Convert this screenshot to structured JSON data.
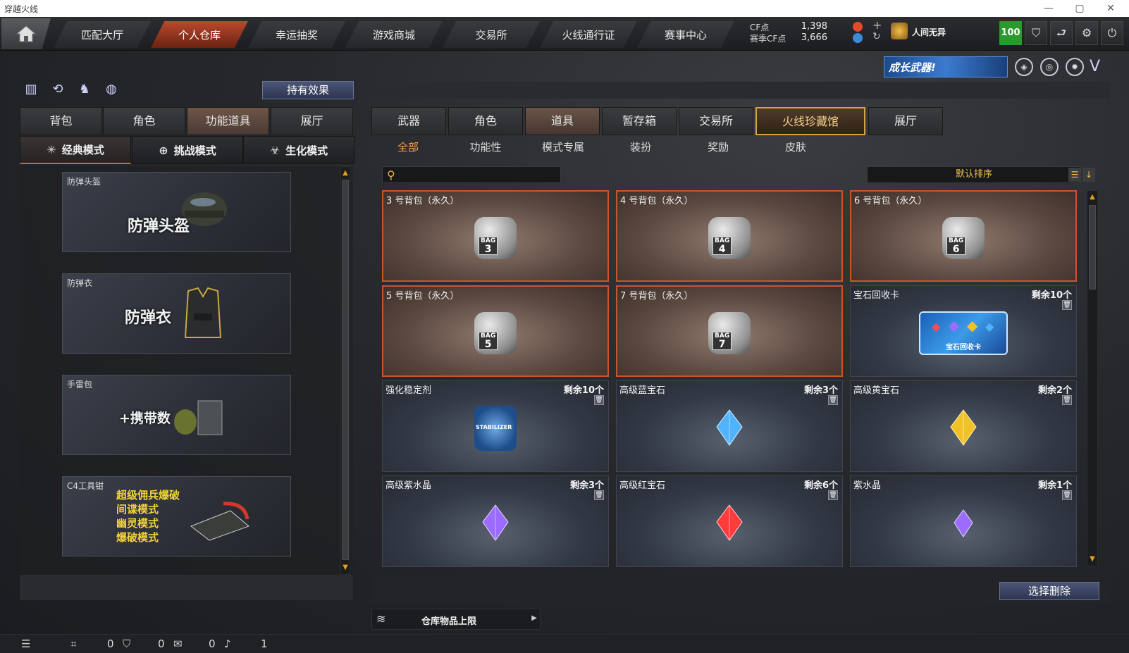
{
  "window": {
    "title": "穿越火线"
  },
  "topnav": {
    "tabs": [
      {
        "label": "匹配大厅"
      },
      {
        "label": "个人仓库"
      },
      {
        "label": "幸运抽奖"
      },
      {
        "label": "游戏商城"
      },
      {
        "label": "交易所"
      },
      {
        "label": "火线通行证"
      },
      {
        "label": "赛事中心"
      }
    ],
    "active_tab": "个人仓库",
    "cf_label": "CF点",
    "cf_value": "1,398",
    "season_cf_label": "赛季CF点",
    "season_cf_value": "3,666",
    "username": "人间无异",
    "level": "100",
    "icons": [
      "home-icon",
      "plus-icon",
      "refresh-icon",
      "rank-emblem-icon",
      "shield-icon",
      "return-icon",
      "gear-icon",
      "power-icon"
    ]
  },
  "banner": {
    "text": "成长武器!"
  },
  "left": {
    "hold_effect_label": "持有效果",
    "tabs": [
      "背包",
      "角色",
      "功能道具",
      "展厅"
    ],
    "active_tab": "功能道具",
    "modes": [
      "经典模式",
      "挑战模式",
      "生化模式"
    ],
    "active_mode": "经典模式",
    "cards": [
      {
        "caption": "防弹头盔",
        "big": "防弹头盔"
      },
      {
        "caption": "防弹衣",
        "big": "防弹衣"
      },
      {
        "caption": "手雷包",
        "big": "+携带数"
      },
      {
        "caption": "C4工具钳",
        "lines": [
          "超级佣兵爆破",
          "间谍模式",
          "幽灵模式",
          "爆破模式"
        ]
      }
    ]
  },
  "right": {
    "tabs": [
      "武器",
      "角色",
      "道具",
      "暂存箱",
      "交易所",
      "火线珍藏馆",
      "展厅"
    ],
    "active_tab": "火线珍藏馆",
    "subtabs": [
      "全部",
      "功能性",
      "模式专属",
      "装扮",
      "奖励",
      "皮肤"
    ],
    "active_subtab": "全部",
    "search_placeholder": "",
    "sort_label": "默认排序",
    "items": [
      {
        "name": "3 号背包（永久）",
        "count": "",
        "type": "bag",
        "bag_no": "3"
      },
      {
        "name": "4 号背包（永久）",
        "count": "",
        "type": "bag",
        "bag_no": "4"
      },
      {
        "name": "6 号背包（永久）",
        "count": "",
        "type": "bag",
        "bag_no": "6"
      },
      {
        "name": "5 号背包（永久）",
        "count": "",
        "type": "bag",
        "bag_no": "5"
      },
      {
        "name": "7 号背包（永久）",
        "count": "",
        "type": "bag",
        "bag_no": "7"
      },
      {
        "name": "宝石回收卡",
        "count": "剩余10个",
        "type": "card",
        "art_text": "宝石回收卡"
      },
      {
        "name": "强化稳定剂",
        "count": "剩余10个",
        "type": "stabilizer",
        "art_text": "STABILIZER"
      },
      {
        "name": "高级蓝宝石",
        "count": "剩余3个",
        "type": "gem",
        "color": "#4fb3ff"
      },
      {
        "name": "高级黄宝石",
        "count": "剩余2个",
        "type": "gem",
        "color": "#f0c22a"
      },
      {
        "name": "高级紫水晶",
        "count": "剩余3个",
        "type": "gem",
        "color": "#9b6cff"
      },
      {
        "name": "高级红宝石",
        "count": "剩余6个",
        "type": "gem",
        "color": "#ff3b3b"
      },
      {
        "name": "紫水晶",
        "count": "剩余1个",
        "type": "gem-small",
        "color": "#9b6cff"
      }
    ],
    "select_delete_label": "选择删除",
    "storage_limit_label": "仓库物品上限"
  },
  "statusbar": {
    "values": [
      "0",
      "0",
      "0",
      "1"
    ]
  },
  "colors": {
    "accent": "#c9552c",
    "gold": "#f1c04a",
    "level_green": "#2b9a2d"
  }
}
